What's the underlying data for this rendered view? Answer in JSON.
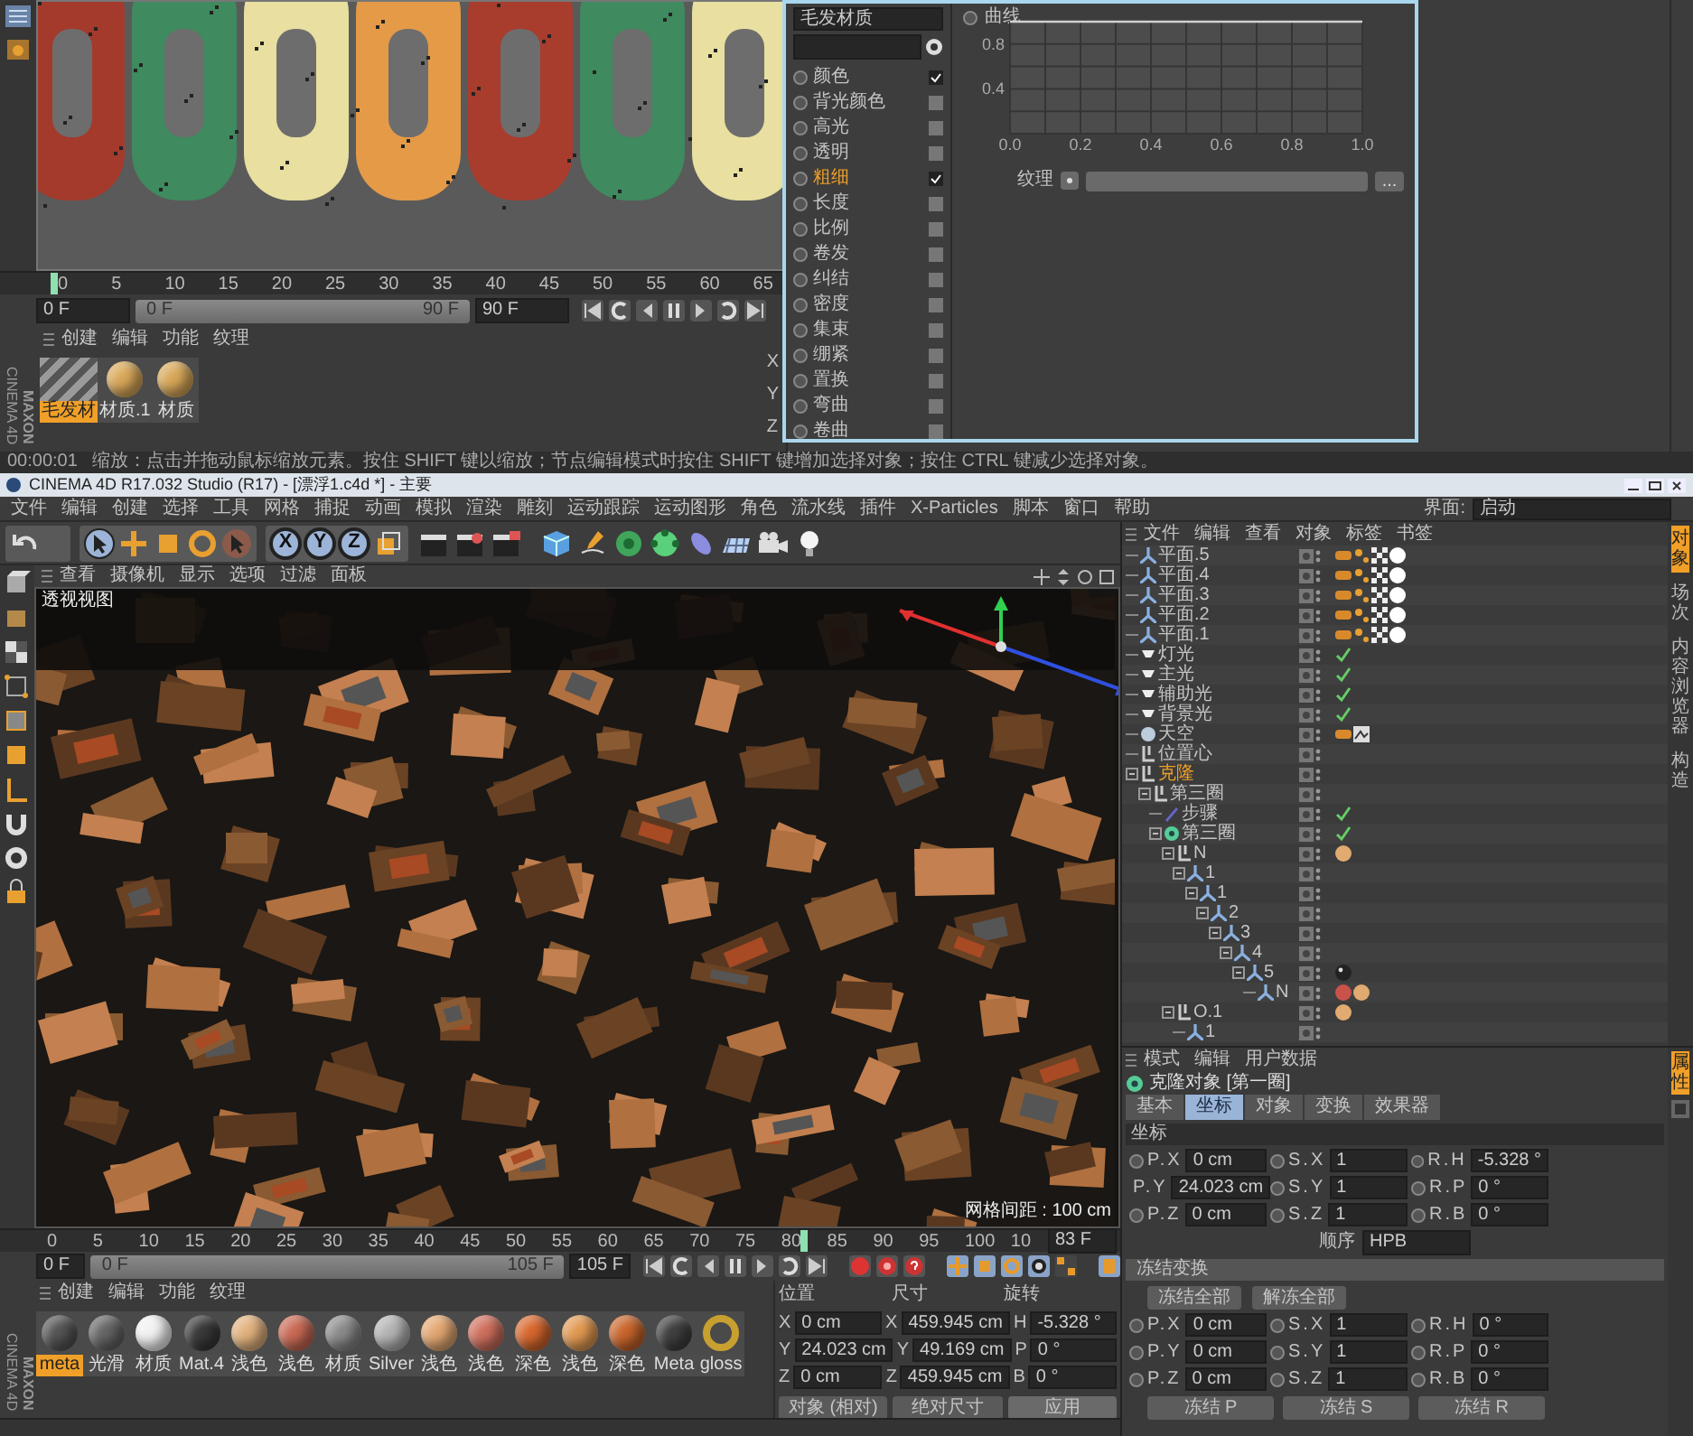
{
  "top_window": {
    "timeline": {
      "ticks": [
        "0",
        "5",
        "10",
        "15",
        "20",
        "25",
        "30",
        "35",
        "40",
        "45",
        "50",
        "55",
        "60",
        "65"
      ],
      "level": 0
    },
    "frames": {
      "start": "0 F",
      "range_start": "0 F",
      "range_end": "90 F",
      "end": "90 F",
      "level": 1
    },
    "material_menu": [
      "创建",
      "编辑",
      "功能",
      "纹理"
    ],
    "materials": [
      {
        "label": "毛发材",
        "selected": true,
        "kind": "striped",
        "color": "#9a9a9a"
      },
      {
        "label": "材质.1",
        "selected": false,
        "kind": "sphere",
        "color": "#d9a95a"
      },
      {
        "label": "材质",
        "selected": false,
        "kind": "sphere",
        "color": "#d9a95a"
      }
    ],
    "coord_axes": [
      "X",
      "Y",
      "Z"
    ],
    "logo": {
      "brand": "MAXON",
      "product": "CINEMA 4D"
    },
    "status": {
      "time": "00:00:01",
      "message": "缩放：点击并拖动鼠标缩放元素。按住 SHIFT 键以缩放；节点编辑模式时按住 SHIFT 键增加选择对象；按住 CTRL 键减少选择对象。"
    }
  },
  "material_editor": {
    "name": "毛发材质",
    "channels": [
      {
        "label": "颜色",
        "checked": true,
        "selected": false
      },
      {
        "label": "背光颜色",
        "checked": false,
        "selected": false
      },
      {
        "label": "高光",
        "checked": false,
        "selected": false
      },
      {
        "label": "透明",
        "checked": false,
        "selected": false
      },
      {
        "label": "粗细",
        "checked": true,
        "selected": true
      },
      {
        "label": "长度",
        "checked": false,
        "selected": false
      },
      {
        "label": "比例",
        "checked": false,
        "selected": false
      },
      {
        "label": "卷发",
        "checked": false,
        "selected": false
      },
      {
        "label": "纠结",
        "checked": false,
        "selected": false
      },
      {
        "label": "密度",
        "checked": false,
        "selected": false
      },
      {
        "label": "集束",
        "checked": false,
        "selected": false
      },
      {
        "label": "绷紧",
        "checked": false,
        "selected": false
      },
      {
        "label": "置换",
        "checked": false,
        "selected": false
      },
      {
        "label": "弯曲",
        "checked": false,
        "selected": false
      },
      {
        "label": "卷曲",
        "checked": false,
        "selected": false
      }
    ],
    "chart_data": {
      "type": "line",
      "x": [
        0,
        1
      ],
      "series": [
        {
          "name": "曲线",
          "color": "#d0d0d0",
          "values": [
            1,
            1
          ]
        }
      ],
      "xlim": [
        0,
        1
      ],
      "ylim": [
        0,
        1
      ],
      "grid": true,
      "xticks": [
        {
          "value": 0,
          "label": "0.0"
        },
        0.2,
        0.4,
        0.6,
        0.8,
        {
          "value": 1,
          "label": "1.0"
        }
      ],
      "yticks": [
        0.4,
        0.8
      ]
    },
    "texture_label": "纹理",
    "texture_button": "..."
  },
  "main_window": {
    "title": "CINEMA 4D R17.032 Studio (R17) - [漂浮1.c4d *] - 主要",
    "menu": [
      "文件",
      "编辑",
      "创建",
      "选择",
      "工具",
      "网格",
      "捕捉",
      "动画",
      "模拟",
      "渲染",
      "雕刻",
      "运动跟踪",
      "运动图形",
      "角色",
      "流水线",
      "插件",
      "X-Particles",
      "脚本",
      "窗口",
      "帮助"
    ],
    "layout_label": "界面:",
    "layout_value": "启动",
    "axis_buttons": [
      "X",
      "Y",
      "Z"
    ],
    "viewport": {
      "menu": [
        "查看",
        "摄像机",
        "显示",
        "选项",
        "过滤",
        "面板"
      ],
      "label": "透视视图",
      "grid_label": "网格间距 : 100 cm"
    },
    "timeline": {
      "ticks": [
        "0",
        "5",
        "10",
        "15",
        "20",
        "25",
        "30",
        "35",
        "40",
        "45",
        "50",
        "55",
        "60",
        "65",
        "70",
        "75",
        "80",
        "85",
        "90",
        "95",
        "100",
        "10"
      ],
      "level": 0.79,
      "current": "83 F"
    },
    "frames": {
      "start": "0 F",
      "range_start": "0 F",
      "range_end": "105 F",
      "end": "105 F",
      "level": 1
    },
    "material_menu": [
      "创建",
      "编辑",
      "功能",
      "纹理"
    ],
    "materials": [
      {
        "label": "meta",
        "selected": true,
        "kind": "sphere",
        "color": "#555555"
      },
      {
        "label": "光滑",
        "selected": false,
        "kind": "sphere",
        "color": "#666666"
      },
      {
        "label": "材质",
        "selected": false,
        "kind": "sphere",
        "color": "#f2f2f2"
      },
      {
        "label": "Mat.4",
        "selected": false,
        "kind": "sphere",
        "color": "#3a3a3a"
      },
      {
        "label": "浅色",
        "selected": false,
        "kind": "sphere",
        "color": "#e2b27e"
      },
      {
        "label": "浅色",
        "selected": false,
        "kind": "sphere",
        "color": "#c96a55"
      },
      {
        "label": "材质",
        "selected": false,
        "kind": "sphere",
        "color": "#8c8c8c"
      },
      {
        "label": "Silver",
        "selected": false,
        "kind": "sphere",
        "color": "#b4b4b4"
      },
      {
        "label": "浅色",
        "selected": false,
        "kind": "sphere",
        "color": "#e4a872"
      },
      {
        "label": "浅色",
        "selected": false,
        "kind": "sphere",
        "color": "#d0705e"
      },
      {
        "label": "深色",
        "selected": false,
        "kind": "sphere",
        "color": "#d8682e"
      },
      {
        "label": "浅色",
        "selected": false,
        "kind": "sphere",
        "color": "#e29a52"
      },
      {
        "label": "深色",
        "selected": false,
        "kind": "sphere",
        "color": "#c9662c"
      },
      {
        "label": "Meta",
        "selected": false,
        "kind": "sphere",
        "color": "#404040"
      },
      {
        "label": "gloss",
        "selected": false,
        "kind": "knot",
        "color": "#c8a030"
      }
    ],
    "coordinates": {
      "headers": [
        "位置",
        "尺寸",
        "旋转"
      ],
      "rows": [
        {
          "pos_label": "X",
          "pos": "0 cm",
          "size_label": "X",
          "size": "459.945 cm",
          "rot_label": "H",
          "rot": "-5.328 °"
        },
        {
          "pos_label": "Y",
          "pos": "24.023 cm",
          "size_label": "Y",
          "size": "49.169 cm",
          "rot_label": "P",
          "rot": "0 °"
        },
        {
          "pos_label": "Z",
          "pos": "0 cm",
          "size_label": "Z",
          "size": "459.945 cm",
          "rot_label": "B",
          "rot": "0 °"
        }
      ],
      "mode": "对象 (相对)",
      "size_mode": "绝对尺寸",
      "apply": "应用"
    },
    "logo": {
      "brand": "MAXON",
      "product": "CINEMA 4D"
    }
  },
  "object_manager": {
    "menu": [
      "文件",
      "编辑",
      "查看",
      "对象",
      "标签",
      "书签"
    ],
    "items": [
      {
        "name": "平面.5",
        "kind": "plane",
        "selected": false,
        "tags": [
          {
            "kind": "texture"
          },
          {
            "kind": "phong"
          },
          {
            "kind": "checker"
          },
          {
            "kind": "ball"
          }
        ]
      },
      {
        "name": "平面.4",
        "kind": "plane",
        "selected": false,
        "tags": [
          {
            "kind": "texture"
          },
          {
            "kind": "phong"
          },
          {
            "kind": "checker"
          },
          {
            "kind": "ball"
          }
        ]
      },
      {
        "name": "平面.3",
        "kind": "plane",
        "selected": false,
        "tags": [
          {
            "kind": "texture"
          },
          {
            "kind": "phong"
          },
          {
            "kind": "checker"
          },
          {
            "kind": "ball"
          }
        ]
      },
      {
        "name": "平面.2",
        "kind": "plane",
        "selected": false,
        "tags": [
          {
            "kind": "texture"
          },
          {
            "kind": "phong"
          },
          {
            "kind": "checker"
          },
          {
            "kind": "ball"
          }
        ]
      },
      {
        "name": "平面.1",
        "kind": "plane",
        "selected": false,
        "tags": [
          {
            "kind": "texture"
          },
          {
            "kind": "phong"
          },
          {
            "kind": "checker"
          },
          {
            "kind": "ball"
          }
        ]
      },
      {
        "name": "灯光",
        "kind": "light",
        "selected": false,
        "tags": [
          {
            "kind": "check"
          }
        ]
      },
      {
        "name": "主光",
        "kind": "light",
        "selected": false,
        "tags": [
          {
            "kind": "check"
          }
        ]
      },
      {
        "name": "辅助光",
        "kind": "light",
        "selected": false,
        "tags": [
          {
            "kind": "check"
          }
        ]
      },
      {
        "name": "背景光",
        "kind": "light",
        "selected": false,
        "tags": [
          {
            "kind": "check"
          }
        ]
      },
      {
        "name": "天空",
        "kind": "sky",
        "selected": false,
        "tags": [
          {
            "kind": "texture"
          },
          {
            "kind": "sky"
          }
        ]
      },
      {
        "name": "位置心",
        "kind": "null",
        "selected": false
      },
      {
        "name": "克隆",
        "kind": "null",
        "selected": true,
        "children": [
          {
            "name": "第三圈",
            "kind": "null",
            "selected": false,
            "children": [
              {
                "name": "步骤",
                "kind": "effector",
                "selected": false,
                "tags": [
                  {
                    "kind": "check"
                  }
                ]
              },
              {
                "name": "第三圈",
                "kind": "cloner",
                "selected": false,
                "tags": [
                  {
                    "kind": "check"
                  }
                ],
                "children": [
                  {
                    "name": "N",
                    "kind": "null",
                    "selected": false,
                    "tags": [
                      {
                        "kind": "wood"
                      }
                    ],
                    "children": [
                      {
                        "name": "1",
                        "kind": "plane",
                        "selected": false,
                        "children": [
                          {
                            "name": "1",
                            "kind": "plane",
                            "selected": false,
                            "children": [
                              {
                                "name": "2",
                                "kind": "plane",
                                "selected": false,
                                "children": [
                                  {
                                    "name": "3",
                                    "kind": "plane",
                                    "selected": false,
                                    "children": [
                                      {
                                        "name": "4",
                                        "kind": "plane",
                                        "selected": false,
                                        "children": [
                                          {
                                            "name": "5",
                                            "kind": "plane",
                                            "selected": false,
                                            "tags": [
                                              {
                                                "kind": "dark"
                                              }
                                            ],
                                            "children": [
                                              {
                                                "name": "N",
                                                "kind": "plane",
                                                "selected": false,
                                                "tags": [
                                                  {
                                                    "kind": "red"
                                                  },
                                                  {
                                                    "kind": "wood"
                                                  }
                                                ]
                                              }
                                            ]
                                          }
                                        ]
                                      }
                                    ]
                                  }
                                ]
                              }
                            ]
                          }
                        ]
                      }
                    ]
                  },
                  {
                    "name": "O.1",
                    "kind": "null",
                    "selected": false,
                    "tags": [
                      {
                        "kind": "wood"
                      }
                    ],
                    "children": [
                      {
                        "name": "1",
                        "kind": "plane",
                        "selected": false
                      }
                    ]
                  }
                ]
              }
            ]
          }
        ]
      }
    ],
    "side_tabs": [
      {
        "label": "对象",
        "selected": true
      },
      {
        "label": "场次",
        "selected": false
      },
      {
        "label": "内容浏览器",
        "selected": false
      },
      {
        "label": "构造",
        "selected": false
      }
    ]
  },
  "attribute_manager": {
    "menu": [
      "模式",
      "编辑",
      "用户数据"
    ],
    "title": "克隆对象 [第一圈]",
    "tabs": [
      {
        "label": "基本",
        "selected": false
      },
      {
        "label": "坐标",
        "selected": true
      },
      {
        "label": "对象",
        "selected": false
      },
      {
        "label": "变换",
        "selected": false
      },
      {
        "label": "效果器",
        "selected": false
      }
    ],
    "section": "坐标",
    "rows": [
      {
        "cells": [
          {
            "label": "P.X",
            "value": "0 cm"
          },
          {
            "label": "S.X",
            "value": "1"
          },
          {
            "label": "R.H",
            "value": "-5.328 °"
          }
        ]
      },
      {
        "cells": [
          {
            "label": "P.Y",
            "value": "24.023 cm"
          },
          {
            "label": "S.Y",
            "value": "1"
          },
          {
            "label": "R.P",
            "value": "0 °"
          }
        ]
      },
      {
        "cells": [
          {
            "label": "P.Z",
            "value": "0 cm"
          },
          {
            "label": "S.Z",
            "value": "1"
          },
          {
            "label": "R.B",
            "value": "0 °"
          }
        ]
      }
    ],
    "order_label": "顺序",
    "order_value": "HPB",
    "freeze_section": "冻结变换",
    "freeze_buttons": [
      "冻结全部",
      "解冻全部"
    ],
    "freeze_rows": [
      {
        "cells": [
          {
            "label": "P.X",
            "value": "0 cm"
          },
          {
            "label": "S.X",
            "value": "1"
          },
          {
            "label": "R.H",
            "value": "0 °"
          }
        ]
      },
      {
        "cells": [
          {
            "label": "P.Y",
            "value": "0 cm"
          },
          {
            "label": "S.Y",
            "value": "1"
          },
          {
            "label": "R.P",
            "value": "0 °"
          }
        ]
      },
      {
        "cells": [
          {
            "label": "P.Z",
            "value": "0 cm"
          },
          {
            "label": "S.Z",
            "value": "1"
          },
          {
            "label": "R.B",
            "value": "0 °"
          }
        ]
      }
    ],
    "freeze_apply": [
      "冻结 P",
      "冻结 S",
      "冻结 R"
    ],
    "side_tab": "属性"
  }
}
